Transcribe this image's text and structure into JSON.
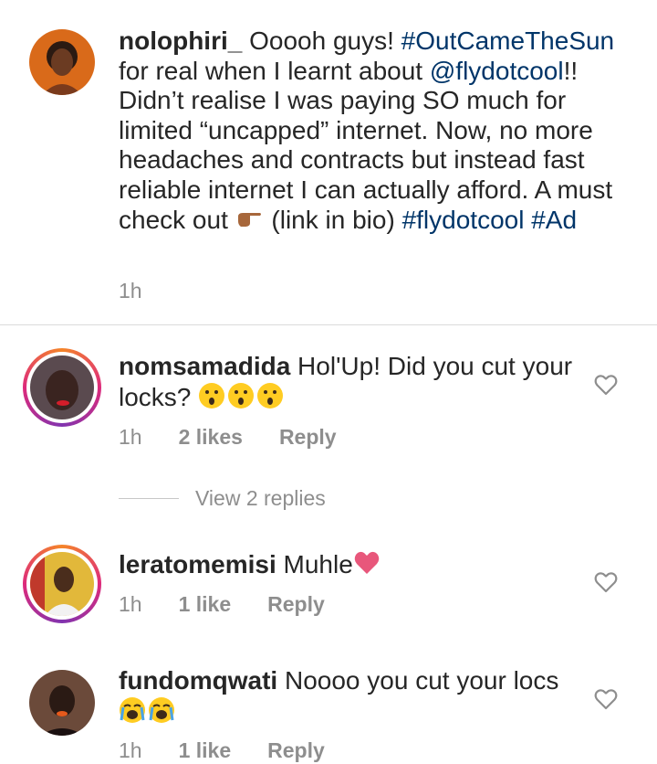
{
  "caption": {
    "username": "nolophiri_",
    "text_1": " Ooooh guys! ",
    "tag_1": "#OutCameTheSun",
    "text_2": " for real when I learnt about ",
    "tag_2": "@flydotcool",
    "text_3": "!! Didn’t realise I was paying SO much for limited “uncapped” internet. Now, no more headaches and contracts but instead fast reliable internet I can actually afford. A must check out ",
    "emoji": "👉🏾",
    "text_4": " (link in bio) ",
    "tag_3": "#flydotcool",
    "tag_4": "#Ad",
    "time": "1h"
  },
  "comments": [
    {
      "username": "nomsamadida",
      "text": " Hol'Up! Did you cut your locks? ",
      "emoji": "😮😮😮",
      "time": "1h",
      "likes": "2 likes",
      "reply": "Reply",
      "view_replies": "View 2 replies"
    },
    {
      "username": "leratomemisi",
      "text": " Muhle",
      "emoji": "❤️",
      "time": "1h",
      "likes": "1 like",
      "reply": "Reply"
    },
    {
      "username": "fundomqwati",
      "text": " Noooo you cut your locs",
      "emoji": "😭😭",
      "time": "1h",
      "likes": "1 like",
      "reply": "Reply"
    }
  ],
  "icons": {
    "like": "heart-outline-icon",
    "pointing": "backhand-index-pointing-right-icon",
    "surprised": "face-with-open-mouth-icon",
    "crying": "loudly-crying-face-icon",
    "heart": "red-heart-icon"
  },
  "colors": {
    "hashtag": "#003569",
    "meta": "#8e8e8e",
    "divider": "#dbdbdb",
    "heart": "#e8577b"
  }
}
